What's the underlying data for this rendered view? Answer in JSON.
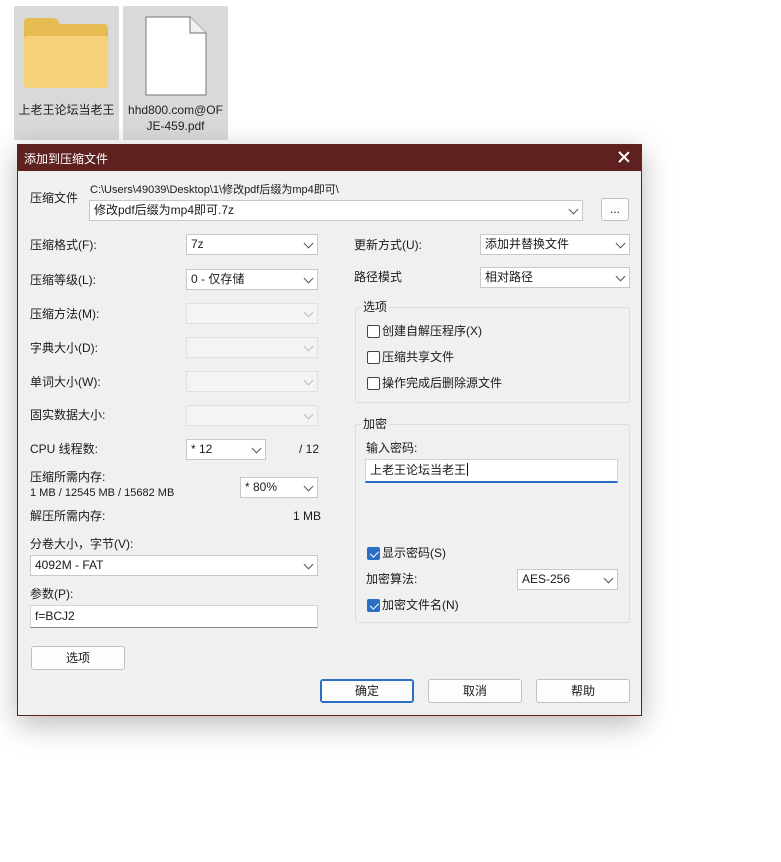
{
  "desktop": {
    "items": [
      {
        "label": "上老王论坛当老王",
        "kind": "folder"
      },
      {
        "label": "hhd800.com@OFJE-459.pdf",
        "kind": "file"
      }
    ]
  },
  "dialog": {
    "title": "添加到压缩文件",
    "archive": {
      "label": "压缩文件",
      "path": "C:\\Users\\49039\\Desktop\\1\\修改pdf后缀为mp4即可\\",
      "name": "修改pdf后缀为mp4即可.7z",
      "browse_label": "..."
    },
    "left": {
      "format": {
        "label": "压缩格式(F):",
        "value": "7z"
      },
      "level": {
        "label": "压缩等级(L):",
        "value": "0 - 仅存储"
      },
      "method": {
        "label": "压缩方法(M):",
        "value": ""
      },
      "dict": {
        "label": "字典大小(D):",
        "value": ""
      },
      "word": {
        "label": "单词大小(W):",
        "value": ""
      },
      "solid": {
        "label": "固实数据大小:",
        "value": ""
      },
      "cpu": {
        "label": "CPU 线程数:",
        "value": "* 12",
        "total": "/ 12"
      },
      "mem_compress": {
        "label": "压缩所需内存:",
        "detail": "1 MB / 12545 MB / 15682 MB",
        "value": "* 80%"
      },
      "mem_decompress": {
        "label": "解压所需内存:",
        "value": "1 MB"
      },
      "volume": {
        "label": "分卷大小，字节(V):",
        "value": "4092M - FAT"
      },
      "params": {
        "label": "参数(P):",
        "value": "f=BCJ2"
      },
      "options_button": "选项"
    },
    "right": {
      "update": {
        "label": "更新方式(U):",
        "value": "添加并替换文件"
      },
      "path_mode": {
        "label": "路径模式",
        "value": "相对路径"
      },
      "options": {
        "title": "选项",
        "items": [
          {
            "label": "创建自解压程序(X)",
            "checked": false
          },
          {
            "label": "压缩共享文件",
            "checked": false
          },
          {
            "label": "操作完成后删除源文件",
            "checked": false
          }
        ]
      },
      "encryption": {
        "title": "加密",
        "password_label": "输入密码:",
        "password_value": "上老王论坛当老王",
        "show_password": {
          "label": "显示密码(S)",
          "checked": true
        },
        "method_label": "加密算法:",
        "method_value": "AES-256",
        "encrypt_names": {
          "label": "加密文件名(N)",
          "checked": true
        }
      }
    },
    "buttons": {
      "ok": "确定",
      "cancel": "取消",
      "help": "帮助"
    }
  }
}
